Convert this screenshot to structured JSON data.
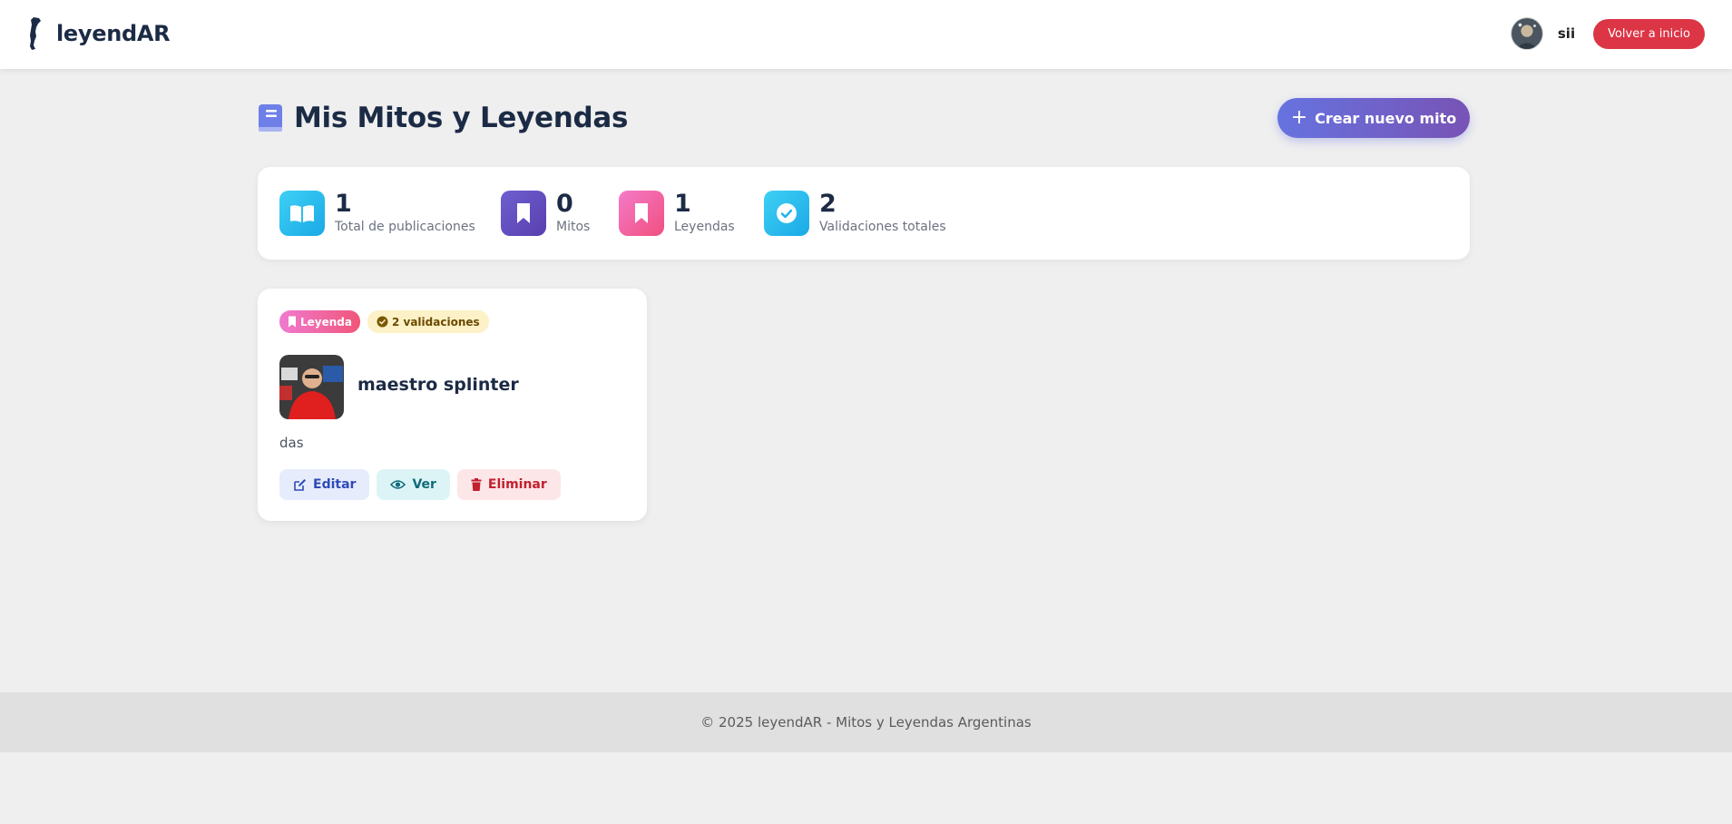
{
  "navbar": {
    "brand": "leyendAR",
    "username": "sii",
    "home_button": "Volver a inicio"
  },
  "header": {
    "title": "Mis Mitos y Leyendas",
    "create_button": "Crear nuevo mito"
  },
  "stats": [
    {
      "value": "1",
      "label": "Total de publicaciones",
      "icon": "open-book-icon",
      "color": "#22c1ee"
    },
    {
      "value": "0",
      "label": "Mitos",
      "icon": "bookmark-icon",
      "color": "#6a55bf"
    },
    {
      "value": "1",
      "label": "Leyendas",
      "icon": "bookmark-icon",
      "color": "#f0609a"
    },
    {
      "value": "2",
      "label": "Validaciones totales",
      "icon": "check-circle-icon",
      "color": "#22c1ee"
    }
  ],
  "posts": [
    {
      "type_badge": "Leyenda",
      "validations_badge": "2 validaciones",
      "title": "maestro splinter",
      "description": "das",
      "actions": {
        "edit": "Editar",
        "view": "Ver",
        "delete": "Eliminar"
      }
    }
  ],
  "footer": {
    "text": "© 2025 leyendAR - Mitos y Leyendas Argentinas"
  },
  "colors": {
    "accent_gradient_start": "#6673e0",
    "accent_gradient_end": "#7853b5",
    "danger": "#dc3545",
    "text_dark": "#1c2b45"
  }
}
